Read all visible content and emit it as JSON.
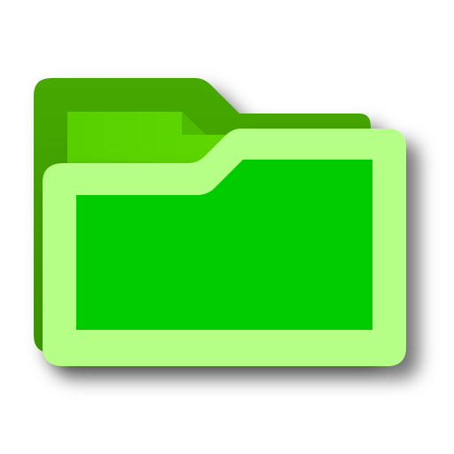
{
  "icon": {
    "name": "folder-icon",
    "colors": {
      "back_dark": "#3f9b00",
      "back_mid": "#4fb800",
      "back_inner": "#5bd200",
      "front_outline": "#b5ff86",
      "front_fill": "#00cc00",
      "shadow": "#000000"
    }
  }
}
